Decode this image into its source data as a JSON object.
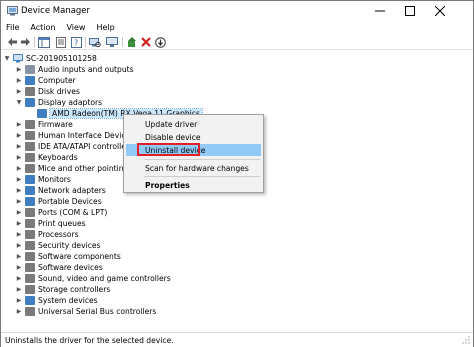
{
  "window": {
    "title": "Device Manager"
  },
  "menu": [
    "File",
    "Action",
    "View",
    "Help"
  ],
  "toolbar": {
    "icons": [
      "back-arrow-icon",
      "forward-arrow-icon",
      "properties-icon",
      "help-icon",
      "properties-sheet-icon",
      "scan-icon",
      "update-driver-icon",
      "uninstall-icon",
      "disable-icon"
    ]
  },
  "tree": {
    "root": "SC-201905101258",
    "items": [
      {
        "label": "Audio inputs and outputs",
        "color": "#7b8a99"
      },
      {
        "label": "Computer",
        "color": "#3f7fc1"
      },
      {
        "label": "Disk drives",
        "color": "#6b6b6b"
      },
      {
        "label": "Display adaptors",
        "color": "#3f7fc1"
      },
      {
        "label": "AMD Radeon(TM) RX Vega 11 Graphics",
        "color": "#3f7fc1"
      },
      {
        "label": "Firmware",
        "color": "#6b6b6b"
      },
      {
        "label": "Human Interface Devices",
        "color": "#6b6b6b"
      },
      {
        "label": "IDE ATA/ATAPI controllers",
        "color": "#6b6b6b"
      },
      {
        "label": "Keyboards",
        "color": "#6b6b6b"
      },
      {
        "label": "Mice and other pointing devices",
        "color": "#6b6b6b"
      },
      {
        "label": "Monitors",
        "color": "#3f7fc1"
      },
      {
        "label": "Network adapters",
        "color": "#3f7fc1"
      },
      {
        "label": "Portable Devices",
        "color": "#3f7fc1"
      },
      {
        "label": "Ports (COM & LPT)",
        "color": "#6b6b6b"
      },
      {
        "label": "Print queues",
        "color": "#6b6b6b"
      },
      {
        "label": "Processors",
        "color": "#6b6b6b"
      },
      {
        "label": "Security devices",
        "color": "#6b6b6b"
      },
      {
        "label": "Software components",
        "color": "#6b6b6b"
      },
      {
        "label": "Software devices",
        "color": "#6b6b6b"
      },
      {
        "label": "Sound, video and game controllers",
        "color": "#6b6b6b"
      },
      {
        "label": "Storage controllers",
        "color": "#6b6b6b"
      },
      {
        "label": "System devices",
        "color": "#3f7fc1"
      },
      {
        "label": "Universal Serial Bus controllers",
        "color": "#6b6b6b"
      }
    ]
  },
  "context_menu": {
    "items": [
      "Update driver",
      "Disable device",
      "Uninstall device",
      "Scan for hardware changes",
      "Properties"
    ],
    "highlighted": "Uninstall device"
  },
  "status": "Uninstalls the driver for the selected device."
}
